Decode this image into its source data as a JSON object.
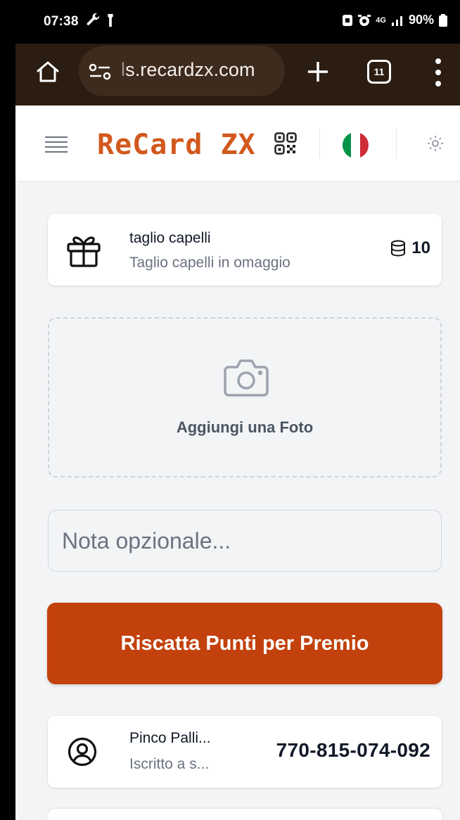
{
  "status_bar": {
    "time": "07:38",
    "network": "4G",
    "battery": "90%"
  },
  "browser": {
    "url_prefix": "l",
    "url": "s.recardzx.com",
    "tab_count": "11"
  },
  "header": {
    "logo": "ReCard ZX"
  },
  "reward": {
    "title": "taglio capelli",
    "subtitle": "Taglio capelli in omaggio",
    "points": "10"
  },
  "photo": {
    "label": "Aggiungi una Foto"
  },
  "note": {
    "placeholder": "Nota opzionale..."
  },
  "redeem": {
    "label": "Riscatta Punti per Premio"
  },
  "customer": {
    "name": "Pinco Palli...",
    "subtitle": "Iscritto a s...",
    "code": "770-815-074-092"
  },
  "colors": {
    "brand": "#d2591d",
    "button": "#c2410c",
    "browser_bar": "#2b1d12",
    "page_bg": "#f3f4f6"
  }
}
